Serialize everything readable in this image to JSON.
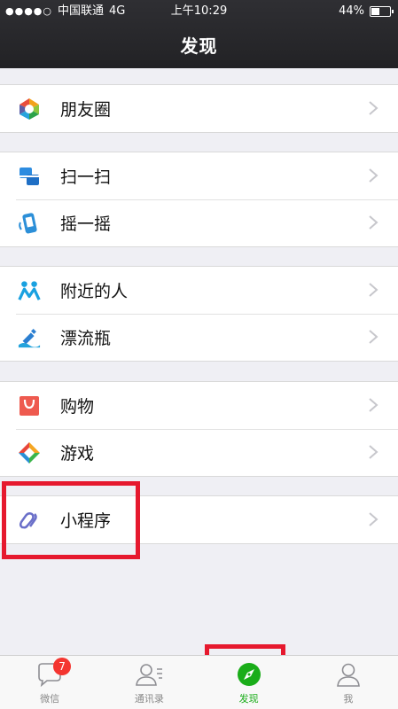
{
  "status_bar": {
    "carrier": "中国联通",
    "network": "4G",
    "time": "上午10:29",
    "battery": "44%",
    "battery_level": 0.44
  },
  "header": {
    "title": "发现"
  },
  "groups": [
    {
      "items": [
        {
          "label": "朋友圈",
          "icon": "moments-icon"
        }
      ]
    },
    {
      "items": [
        {
          "label": "扫一扫",
          "icon": "scan-icon"
        },
        {
          "label": "摇一摇",
          "icon": "shake-icon"
        }
      ]
    },
    {
      "items": [
        {
          "label": "附近的人",
          "icon": "people-nearby-icon"
        },
        {
          "label": "漂流瓶",
          "icon": "drift-bottle-icon"
        }
      ]
    },
    {
      "items": [
        {
          "label": "购物",
          "icon": "shopping-icon"
        },
        {
          "label": "游戏",
          "icon": "games-icon"
        }
      ]
    },
    {
      "items": [
        {
          "label": "小程序",
          "icon": "mini-program-icon"
        }
      ]
    }
  ],
  "tabbar": {
    "tabs": [
      {
        "label": "微信",
        "badge": "7",
        "icon": "chat-icon"
      },
      {
        "label": "通讯录",
        "icon": "contacts-icon"
      },
      {
        "label": "发现",
        "icon": "discover-icon",
        "active": true
      },
      {
        "label": "我",
        "icon": "me-icon"
      }
    ]
  },
  "colors": {
    "accent_green": "#1aad19",
    "highlight_red": "#e6192e",
    "badge_red": "#f43530"
  }
}
